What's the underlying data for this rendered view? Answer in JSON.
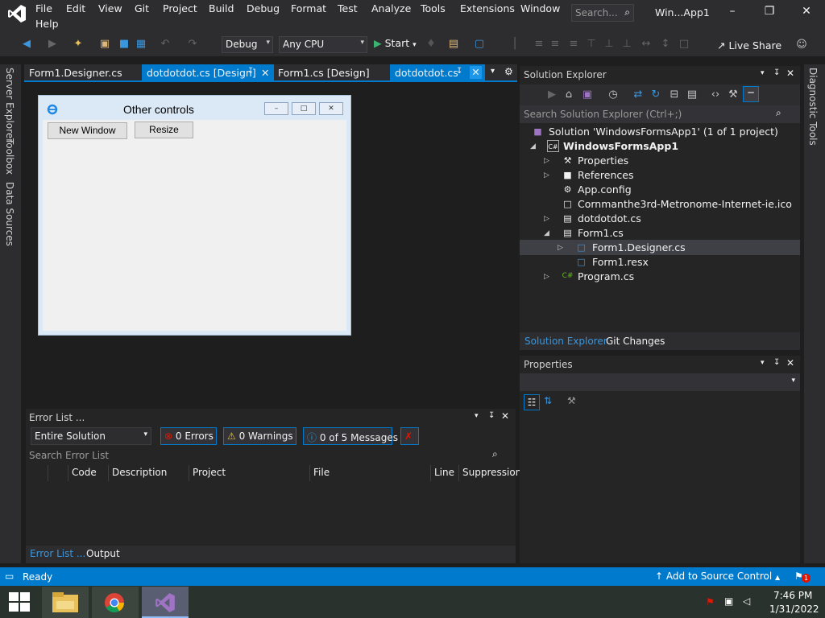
{
  "menubar": {
    "items": [
      "File",
      "Edit",
      "View",
      "Git",
      "Project",
      "Build",
      "Debug",
      "Format",
      "Test",
      "Analyze",
      "Tools",
      "Extensions",
      "Window",
      "Help"
    ],
    "search_placeholder": "Search...",
    "title": "Win...App1"
  },
  "toolbar": {
    "config": "Debug",
    "platform": "Any CPU",
    "start_label": "Start",
    "live_share": "Live Share"
  },
  "side_tabs": {
    "left": [
      "Server Explorer",
      "Toolbox",
      "Data Sources"
    ],
    "right": [
      "Diagnostic Tools"
    ]
  },
  "doc_tabs": [
    {
      "label": "Form1.Designer.cs",
      "active": false
    },
    {
      "label": "dotdotdot.cs [Design]",
      "active": true
    },
    {
      "label": "Form1.cs [Design]",
      "active": false
    },
    {
      "label": "dotdotdot.cs",
      "active": true
    }
  ],
  "form": {
    "title": "Other controls",
    "buttons": [
      "New Window",
      "Resize"
    ]
  },
  "error_list": {
    "title": "Error List ...",
    "scope": "Entire Solution",
    "errors": "0 Errors",
    "warnings": "0 Warnings",
    "messages": "0 of 5 Messages",
    "search_placeholder": "Search Error List",
    "columns": [
      "Code",
      "Description",
      "Project",
      "File",
      "Line",
      "Suppression"
    ],
    "bottom_tabs": [
      "Error List ...",
      "Output"
    ]
  },
  "solution_explorer": {
    "title": "Solution Explorer",
    "search_placeholder": "Search Solution Explorer (Ctrl+;)",
    "items": [
      {
        "label": "Solution 'WindowsFormsApp1' (1 of 1 project)",
        "icon": "solution-icon"
      },
      {
        "label": "WindowsFormsApp1",
        "icon": "csharp-project-icon"
      },
      {
        "label": "Properties",
        "icon": "wrench-icon"
      },
      {
        "label": "References",
        "icon": "references-icon"
      },
      {
        "label": "App.config",
        "icon": "config-file-icon"
      },
      {
        "label": "Cornmanthe3rd-Metronome-Internet-ie.ico",
        "icon": "ico-file-icon"
      },
      {
        "label": "dotdotdot.cs",
        "icon": "form-icon"
      },
      {
        "label": "Form1.cs",
        "icon": "form-icon"
      },
      {
        "label": "Form1.Designer.cs",
        "icon": "cs-file-icon"
      },
      {
        "label": "Form1.resx",
        "icon": "resx-file-icon"
      },
      {
        "label": "Program.cs",
        "icon": "csharp-file-icon"
      }
    ],
    "bottom_tabs": [
      "Solution Explorer",
      "Git Changes"
    ]
  },
  "properties": {
    "title": "Properties"
  },
  "status": {
    "ready": "Ready",
    "source_control": "Add to Source Control",
    "notif_count": "1"
  },
  "taskbar": {
    "time": "7:46 PM",
    "date": "1/31/2022"
  },
  "colors": {
    "accent": "#007acc",
    "bg": "#1e1e1e",
    "panel": "#252526",
    "chrome": "#2d2d30"
  }
}
